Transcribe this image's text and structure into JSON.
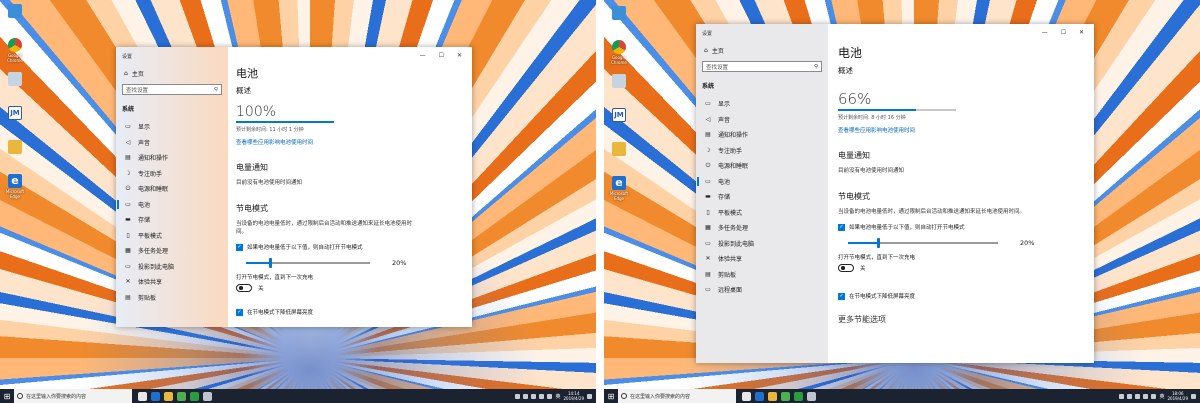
{
  "desktop_icons": [
    "",
    "Google Chrome",
    "",
    "",
    "",
    "Microsoft Edge"
  ],
  "settings": {
    "window_title": "设置",
    "home": "主页",
    "search_placeholder": "查找设置",
    "section": "系统",
    "items": [
      "显示",
      "声音",
      "通知和操作",
      "专注助手",
      "电源和睡眠",
      "电池",
      "存储",
      "平板模式",
      "多任务处理",
      "投影到此电脑",
      "体验共享",
      "剪贴板",
      "远程桌面"
    ],
    "active_index": 5,
    "page_title": "电池",
    "overview": "概述",
    "remain_link": "查看哪些应用影响电池使用时间",
    "notify_title": "电量通知",
    "notify_text": "目前没有电池使用时间通知",
    "saver_title": "节电模式",
    "saver_desc": "当设备的电池电量低时，通过限制后台活动和推送通知来延长电池使用时间。",
    "auto_on": "如果电池电量低于以下值，则自动打开节电模式",
    "slider_value": "20%",
    "slider_fraction": 0.2,
    "toggle_label": "打开节电模式，直到下一次充电",
    "toggle_state": "关",
    "lower_brightness": "在节电模式下降低屏幕亮度",
    "more_options": "更多节能选项"
  },
  "left": {
    "percent": "100%",
    "fill": 1.0,
    "remaining": "预计剩余时间: 11 小时 1 分钟"
  },
  "right": {
    "percent": "66%",
    "fill": 0.66,
    "remaining": "预计剩余时间: 8 小时 16 分钟"
  },
  "taskbar": {
    "search_text": "在这里输入你要搜索的内容",
    "left_time": "14:14",
    "left_date": "2019/4/29",
    "right_time": "18:06",
    "right_date": "2019/4/29",
    "lang": "英"
  },
  "icons": {
    "home": "⌂",
    "display": "▭",
    "sound": "◁",
    "notify": "▤",
    "focus": "☽",
    "power": "⏻",
    "battery": "▭",
    "storage": "▬",
    "tablet": "▯",
    "multitask": "▦",
    "project": "▭",
    "share": "✕",
    "clipboard": "▤",
    "remote": "▭",
    "search": "⚲"
  }
}
